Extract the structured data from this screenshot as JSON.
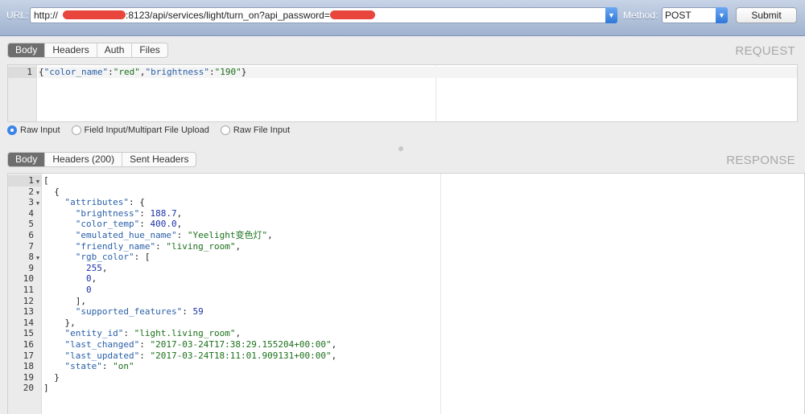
{
  "toolbar": {
    "url_label": "URL:",
    "url_prefix": "http://",
    "url_middle": ":8123/api/services/light/turn_on?api_password=",
    "method_label": "Method:",
    "method_value": "POST",
    "submit_label": "Submit"
  },
  "request": {
    "title": "REQUEST",
    "tabs": [
      "Body",
      "Headers",
      "Auth",
      "Files"
    ],
    "active_tab": "Body",
    "lines": [
      {
        "num": "1",
        "code": "{\"color_name\":\"red\",\"brightness\":\"190\"}"
      }
    ],
    "input_modes": [
      "Raw Input",
      "Field Input/Multipart File Upload",
      "Raw File Input"
    ],
    "selected_input_mode": "Raw Input"
  },
  "response": {
    "title": "RESPONSE",
    "tabs": [
      "Body",
      "Headers (200)",
      "Sent Headers"
    ],
    "active_tab": "Body",
    "lines": [
      {
        "num": "1",
        "fold": true,
        "code": "["
      },
      {
        "num": "2",
        "fold": true,
        "code": "  {"
      },
      {
        "num": "3",
        "fold": true,
        "code": "    \"attributes\": {"
      },
      {
        "num": "4",
        "code": "      \"brightness\": 188.7,"
      },
      {
        "num": "5",
        "code": "      \"color_temp\": 400.0,"
      },
      {
        "num": "6",
        "code": "      \"emulated_hue_name\": \"Yeelight变色灯\","
      },
      {
        "num": "7",
        "code": "      \"friendly_name\": \"living_room\","
      },
      {
        "num": "8",
        "fold": true,
        "code": "      \"rgb_color\": ["
      },
      {
        "num": "9",
        "code": "        255,"
      },
      {
        "num": "10",
        "code": "        0,"
      },
      {
        "num": "11",
        "code": "        0"
      },
      {
        "num": "12",
        "code": "      ],"
      },
      {
        "num": "13",
        "code": "      \"supported_features\": 59"
      },
      {
        "num": "14",
        "code": "    },"
      },
      {
        "num": "15",
        "code": "    \"entity_id\": \"light.living_room\","
      },
      {
        "num": "16",
        "code": "    \"last_changed\": \"2017-03-24T17:38:29.155204+00:00\","
      },
      {
        "num": "17",
        "code": "    \"last_updated\": \"2017-03-24T18:11:01.909131+00:00\","
      },
      {
        "num": "18",
        "code": "    \"state\": \"on\""
      },
      {
        "num": "19",
        "code": "  }"
      },
      {
        "num": "20",
        "code": "]"
      }
    ]
  },
  "colors": {
    "accent": "#3b84e8",
    "redaction": "#e8453c",
    "active_tab": "#6e6e6e"
  },
  "icons": {
    "url_dropdown": "chevron-down-icon",
    "method_dropdown": "chevron-down-icon",
    "fold_toggle": "triangle-down-icon"
  }
}
